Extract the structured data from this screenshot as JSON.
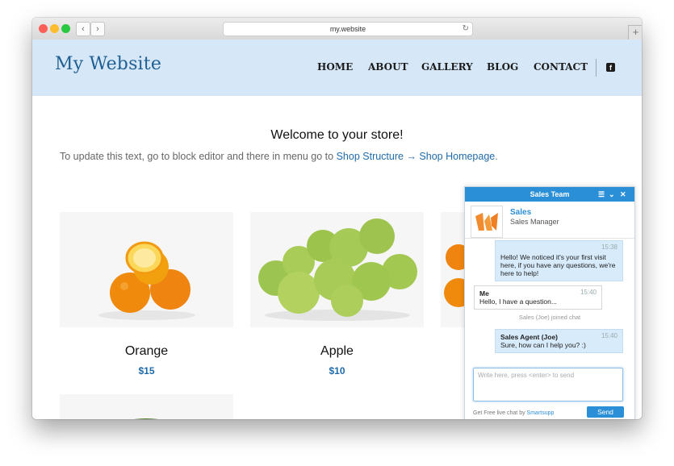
{
  "browser": {
    "url": "my.website",
    "back_label": "‹",
    "forward_label": "›",
    "reload_label": "↻",
    "new_tab_label": "+"
  },
  "site": {
    "logo": "My Website",
    "nav": [
      "HOME",
      "ABOUT",
      "GALLERY",
      "BLOG",
      "CONTACT"
    ],
    "social_icon": "facebook-icon"
  },
  "main": {
    "welcome": "Welcome to your store!",
    "intro_text": "To update this text, go to block editor and there in menu go to",
    "intro_link": "Shop Structure → Shop Homepage",
    "intro_end": "."
  },
  "products": [
    {
      "name": "Orange",
      "price": "$15"
    },
    {
      "name": "Apple",
      "price": "$10"
    }
  ],
  "chat": {
    "title": "Sales Team",
    "agent_name": "Sales",
    "agent_role": "Sales Manager",
    "messages": [
      {
        "time": "15:38",
        "text": "Hello! We noticed it's your first visit here, if you have any questions, we're here to help!"
      },
      {
        "sender": "Me",
        "time": "15:40",
        "text": "Hello, I have a question..."
      },
      {
        "sender": "Sales Agent (Joe)",
        "time": "15:40",
        "text": "Sure, how can I help you? :)"
      }
    ],
    "system_message": "Sales (Joe) joined chat",
    "input_placeholder": "Write here, press <enter> to send",
    "footer_prefix": "Get Free live chat by",
    "footer_brand": "Smartsupp",
    "send_label": "Send"
  },
  "colors": {
    "header_bg": "#d6e8f8",
    "accent": "#1f6aa8",
    "chat_accent": "#2b8fd8"
  }
}
